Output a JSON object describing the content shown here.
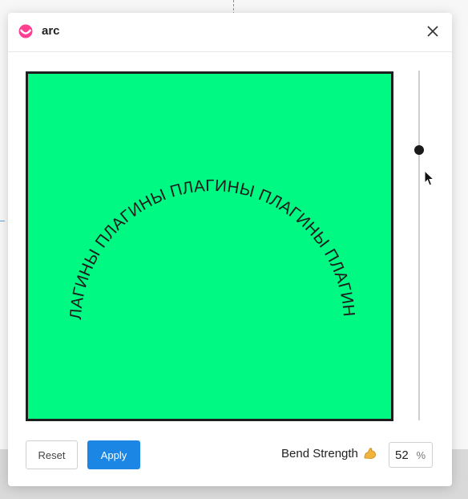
{
  "dialog": {
    "title": "arc",
    "icon": "plugin-logo-icon",
    "close_icon": "close-icon"
  },
  "canvas": {
    "background": "#00f982",
    "border_color": "#1e1e1e",
    "arc_text": "ПЛАГИНЫ ПЛАГИНЫ ПЛАГИНЫ ПЛАГИНЫ ПЛАГИНЫ"
  },
  "slider": {
    "value_fraction": 0.22
  },
  "footer": {
    "reset_label": "Reset",
    "apply_label": "Apply",
    "bend_label": "Bend Strength",
    "bend_icon": "flexed-biceps-icon",
    "bend_value": "52",
    "bend_unit": "%"
  },
  "colors": {
    "accent": "#1b86e3"
  }
}
